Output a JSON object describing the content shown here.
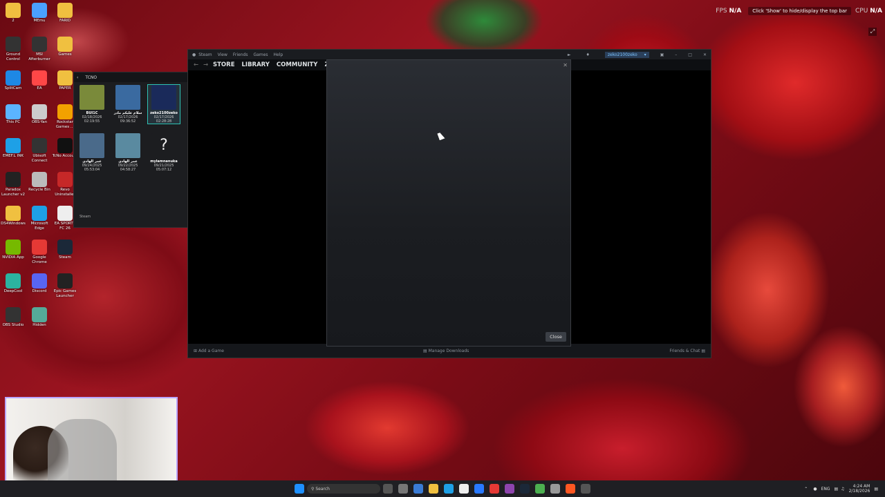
{
  "desktop_icons": [
    {
      "label": "2",
      "icon": "folder-icon",
      "color": "#f0c040"
    },
    {
      "label": "MEmu",
      "icon": "memu-icon",
      "color": "#4aa0ff"
    },
    {
      "label": "FARID",
      "icon": "folder-icon",
      "color": "#f0c040"
    },
    {
      "label": "Ground Control",
      "icon": "ground-control-icon",
      "color": "#333"
    },
    {
      "label": "MSI Afterburner",
      "icon": "msi-afterburner-icon",
      "color": "#333"
    },
    {
      "label": "Games",
      "icon": "folder-icon",
      "color": "#f0c040"
    },
    {
      "label": "SplitCam",
      "icon": "splitcam-icon",
      "color": "#1e88e5"
    },
    {
      "label": "EA",
      "icon": "ea-icon",
      "color": "#ff4747"
    },
    {
      "label": "PAPER",
      "icon": "folder-icon",
      "color": "#f0c040"
    },
    {
      "label": "This PC",
      "icon": "this-pc-icon",
      "color": "#5bb4ff"
    },
    {
      "label": "OBS-Yan",
      "icon": "obs-icon",
      "color": "#ccc"
    },
    {
      "label": "Rockstar Games ...",
      "icon": "rockstar-icon",
      "color": "#f2a100"
    },
    {
      "label": "EMEF.L INK",
      "icon": "edge-icon",
      "color": "#1ea0e6"
    },
    {
      "label": "Ubisoft Connect",
      "icon": "ubisoft-icon",
      "color": "#333"
    },
    {
      "label": "TcNo Accou...",
      "icon": "tcno-icon",
      "color": "#111"
    },
    {
      "label": "Paradox Launcher v2",
      "icon": "paradox-icon",
      "color": "#222"
    },
    {
      "label": "Recycle Bin",
      "icon": "recycle-bin-icon",
      "color": "#bbb"
    },
    {
      "label": "Revo Uninstaller",
      "icon": "revo-icon",
      "color": "#c62828"
    },
    {
      "label": "DS4Windows",
      "icon": "folder-icon",
      "color": "#f0c040"
    },
    {
      "label": "Microsoft Edge",
      "icon": "edge-icon",
      "color": "#1ea0e6"
    },
    {
      "label": "EA SPORTS FC 26",
      "icon": "document-icon",
      "color": "#eee"
    },
    {
      "label": "NVIDIA App",
      "icon": "nvidia-icon",
      "color": "#76b900"
    },
    {
      "label": "Google Chrome",
      "icon": "chrome-icon",
      "color": "#e53935"
    },
    {
      "label": "Steam",
      "icon": "steam-icon",
      "color": "#1b2838"
    },
    {
      "label": "DeepCool",
      "icon": "deepcool-icon",
      "color": "#2bb3a0"
    },
    {
      "label": "Discord",
      "icon": "discord-icon",
      "color": "#5865f2"
    },
    {
      "label": "Epic Games Launcher",
      "icon": "epic-icon",
      "color": "#222"
    },
    {
      "label": "OBS Studio",
      "icon": "obs-icon",
      "color": "#333"
    },
    {
      "label": "Hidden",
      "icon": "hidden-icon",
      "color": "#5a9"
    }
  ],
  "tcno": {
    "title": "TCNO",
    "footer": "Steam",
    "accounts": [
      {
        "name": "BUI1C",
        "date": "02/18/2026 02:19:55",
        "color": "#7a8a3a"
      },
      {
        "name": "سلام علیکم مادر",
        "date": "02/17/2026 09:36:52",
        "color": "#3a6aa0"
      },
      {
        "name": "zeko2100zeko",
        "date": "02/17/2026 02:28:28",
        "color": "#1a2a5a"
      },
      {
        "name": "عمر الهادي",
        "date": "09/24/2025 05:53:04",
        "color": "#4a6a8a"
      },
      {
        "name": "عمر الهادي",
        "date": "09/22/2025 04:58:27",
        "color": "#5a8aa0"
      },
      {
        "name": "mylamnanuka",
        "date": "09/21/2025 05:07:12",
        "color": "#1c1d20"
      }
    ]
  },
  "steam": {
    "menu": [
      "Steam",
      "View",
      "Friends",
      "Games",
      "Help"
    ],
    "nav": [
      "STORE",
      "LIBRARY",
      "COMMUNITY",
      "ZE"
    ],
    "user": "zeko2100zeko",
    "add_game": "Add a Game",
    "manage_downloads": "Manage Downloads",
    "friends_chat": "Friends & Chat",
    "dialog_close": "Close"
  },
  "overlay": {
    "fps_label": "FPS",
    "fps_value": "N/A",
    "rec_text": "Click 'Show' to hide/display the top bar",
    "cpu_label": "CPU",
    "cpu_value": "N/A"
  },
  "taskbar": {
    "search": "Search",
    "lang": "ENG",
    "time": "4:24 AM",
    "date": "2/18/2026"
  }
}
